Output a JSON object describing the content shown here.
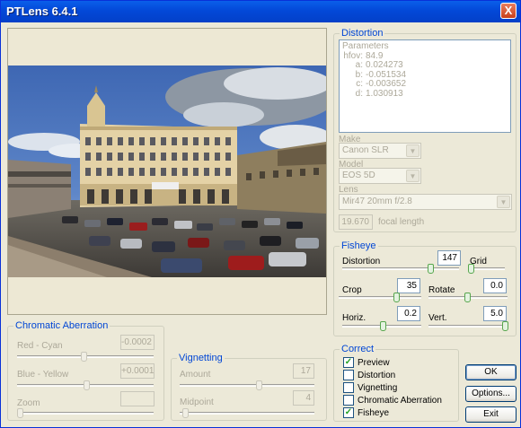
{
  "window": {
    "title": "PTLens 6.4.1",
    "close_glyph": "X"
  },
  "distortion": {
    "title": "Distortion",
    "params_header": "Parameters",
    "params": [
      {
        "k": "hfov:",
        "v": "84.9"
      },
      {
        "k": "a:",
        "v": "0.024273"
      },
      {
        "k": "b:",
        "v": "-0.051534"
      },
      {
        "k": "c:",
        "v": "-0.003652"
      },
      {
        "k": "d:",
        "v": "1.030913"
      }
    ],
    "make_label": "Make",
    "make_value": "Canon SLR",
    "model_label": "Model",
    "model_value": "EOS 5D",
    "lens_label": "Lens",
    "lens_value": "Mir47 20mm f/2.8",
    "focal_value": "19.670",
    "focal_label": "focal length"
  },
  "fisheye": {
    "title": "Fisheye",
    "distortion_label": "Distortion",
    "distortion_value": "147",
    "grid_label": "Grid",
    "crop_label": "Crop",
    "crop_value": "35",
    "rotate_label": "Rotate",
    "rotate_value": "0.0",
    "horiz_label": "Horiz.",
    "horiz_value": "0.2",
    "vert_label": "Vert.",
    "vert_value": "5.0"
  },
  "chromatic": {
    "title": "Chromatic Aberration",
    "red_label": "Red - Cyan",
    "red_value": "-0.0002",
    "blue_label": "Blue - Yellow",
    "blue_value": "+0.0001",
    "zoom_label": "Zoom",
    "zoom_value": ""
  },
  "vignetting": {
    "title": "Vignetting",
    "amount_label": "Amount",
    "amount_value": "17",
    "midpoint_label": "Midpoint",
    "midpoint_value": "4"
  },
  "correct": {
    "title": "Correct",
    "items": [
      {
        "label": "Preview",
        "checked": true
      },
      {
        "label": "Distortion",
        "checked": false
      },
      {
        "label": "Vignetting",
        "checked": false
      },
      {
        "label": "Chromatic Aberration",
        "checked": false
      },
      {
        "label": "Fisheye",
        "checked": true
      }
    ],
    "check_glyph": "✓"
  },
  "buttons": {
    "ok": "OK",
    "options": "Options...",
    "exit": "Exit"
  },
  "colors": {
    "accent": "#0046D5",
    "titlebar": "#0348D8",
    "face": "#ECE9D8"
  }
}
